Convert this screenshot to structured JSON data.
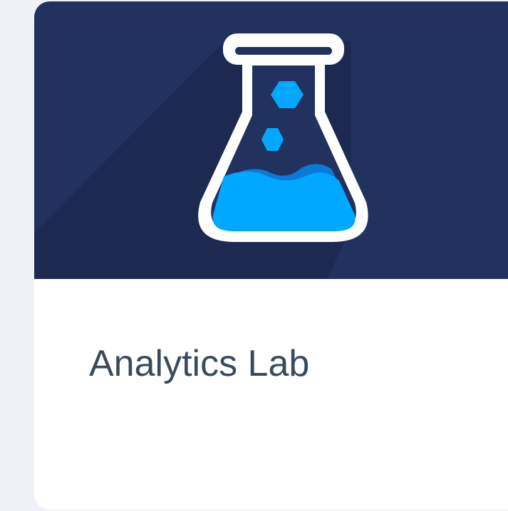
{
  "card": {
    "title": "Analytics Lab",
    "icon": "flask-icon"
  },
  "colors": {
    "page_background": "#eef1f6",
    "banner_background": "#22325e",
    "banner_shadow": "#1c2a52",
    "card_background": "#ffffff",
    "title_text": "#3a4a5e",
    "flask_outline": "#ffffff",
    "liquid": "#00a8ff",
    "liquid_wave": "#0a7ad8",
    "bubbles": "#00a8ff"
  }
}
